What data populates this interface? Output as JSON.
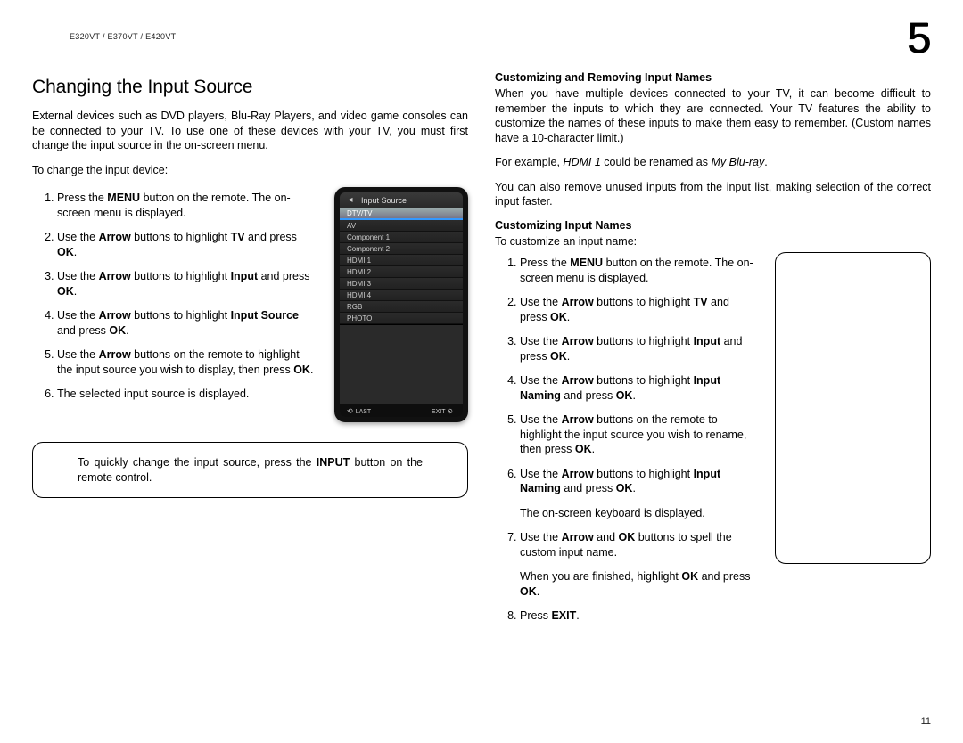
{
  "header": {
    "models": "E320VT / E370VT / E420VT",
    "chapter": "5"
  },
  "page_number": "11",
  "left": {
    "title": "Changing the Input Source",
    "intro": "External devices such as DVD players, Blu-Ray Players, and video game consoles can be connected to your TV. To use one of these devices with your TV, you must first change the input source in the on-screen menu.",
    "lead": "To change the input device:",
    "steps": [
      {
        "pre": "Press the ",
        "b1": "MENU",
        "mid1": " button on the remote. The on-screen menu is displayed."
      },
      {
        "pre": "Use the ",
        "b1": "Arrow",
        "mid1": " buttons to highlight ",
        "b2": "TV",
        "mid2": " and press ",
        "b3": "OK",
        "post": "."
      },
      {
        "pre": "Use the ",
        "b1": "Arrow",
        "mid1": " buttons to highlight ",
        "b2": "Input",
        "mid2": " and press ",
        "b3": "OK",
        "post": "."
      },
      {
        "pre": "Use the ",
        "b1": "Arrow",
        "mid1": " buttons to highlight ",
        "b2": "Input Source",
        "mid2": " and press ",
        "b3": "OK",
        "post": "."
      },
      {
        "pre": "Use the ",
        "b1": "Arrow",
        "mid1": " buttons on the remote to highlight the input source you wish to display, then press ",
        "b2": "OK",
        "post": "."
      },
      {
        "pre": "The selected input source is displayed."
      }
    ],
    "tip": {
      "pre": "To quickly change the input source, press the ",
      "b": "INPUT",
      "post": " button on the remote control."
    }
  },
  "tv_menu": {
    "title": "Input Source",
    "items": [
      "DTV/TV",
      "AV",
      "Component 1",
      "Component 2",
      "HDMI 1",
      "HDMI 2",
      "HDMI 3",
      "HDMI 4",
      "RGB",
      "PHOTO"
    ],
    "selected_index": 0,
    "footer_left": "LAST",
    "footer_right": "EXIT"
  },
  "right": {
    "section1_title": "Customizing and Removing Input Names",
    "section1_p1": "When you have multiple devices connected to your TV, it can become difficult to remember the inputs to which they are connected. Your TV features the ability to customize the names of these inputs to make them easy to remember. (Custom names have a 10-character limit.)",
    "example": {
      "pre": "For example, ",
      "i1": "HDMI 1",
      "mid": " could be renamed as ",
      "i2": "My Blu-ray",
      "post": "."
    },
    "section1_p2": "You can also remove unused inputs from the input list, making selection of the correct input faster.",
    "section2_title": "Customizing Input Names",
    "section2_lead": "To customize an input name:",
    "steps": [
      {
        "pre": "Press the ",
        "b1": "MENU",
        "mid1": " button on the remote. The on-screen menu is displayed."
      },
      {
        "pre": "Use the ",
        "b1": "Arrow",
        "mid1": " buttons to highlight ",
        "b2": "TV",
        "mid2": " and press ",
        "b3": "OK",
        "post": "."
      },
      {
        "pre": "Use the ",
        "b1": "Arrow",
        "mid1": " buttons to highlight ",
        "b2": "Input",
        "mid2": " and press ",
        "b3": "OK",
        "post": "."
      },
      {
        "pre": "Use the ",
        "b1": "Arrow",
        "mid1": " buttons to highlight ",
        "b2": "Input Naming",
        "mid2": " and press ",
        "b3": "OK",
        "post": "."
      },
      {
        "pre": "Use the ",
        "b1": "Arrow",
        "mid1": " buttons on the remote to highlight the input source you wish to rename, then press ",
        "b2": "OK",
        "post": "."
      },
      {
        "pre": "Use the ",
        "b1": "Arrow",
        "mid1": " buttons to highlight ",
        "b2": "Input Naming",
        "mid2": " and press ",
        "b3": "OK",
        "post": ".",
        "extra": "The on-screen keyboard is displayed."
      },
      {
        "pre": "Use the ",
        "b1": "Arrow",
        "mid1": " and ",
        "b2": "OK",
        "mid2": " buttons to spell the custom input name.",
        "extra_pre": "When you are finished, highlight ",
        "extra_b": "OK",
        "extra_mid": " and press ",
        "extra_b2": "OK",
        "extra_post": "."
      },
      {
        "pre": "Press ",
        "b1": "EXIT",
        "post": "."
      }
    ]
  }
}
